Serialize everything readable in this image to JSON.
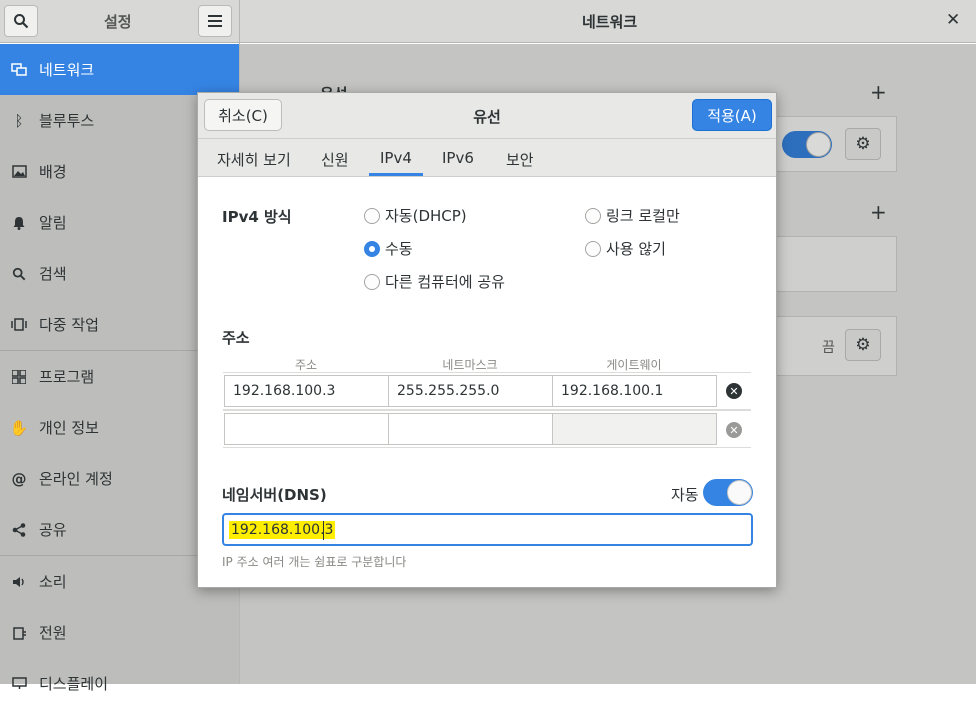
{
  "settings": {
    "title": "설정",
    "search_icon": "search-icon",
    "menu_icon": "hamburger-menu-icon"
  },
  "network_panel": {
    "title": "네트워크",
    "close_icon": "close-icon",
    "wired_heading_partial": "유선",
    "off_label": "끔"
  },
  "sidebar": {
    "items": [
      {
        "label": "네트워크",
        "icon": "network-icon",
        "active": true
      },
      {
        "label": "블루투스",
        "icon": "bluetooth-icon"
      },
      {
        "label": "배경",
        "icon": "background-icon"
      },
      {
        "label": "알림",
        "icon": "bell-icon"
      },
      {
        "label": "검색",
        "icon": "search-icon"
      },
      {
        "label": "다중 작업",
        "icon": "multitasking-icon"
      },
      {
        "label": "프로그램",
        "icon": "apps-grid-icon"
      },
      {
        "label": "개인 정보",
        "icon": "hand-icon"
      },
      {
        "label": "온라인 계정",
        "icon": "at-icon"
      },
      {
        "label": "공유",
        "icon": "share-icon"
      },
      {
        "label": "소리",
        "icon": "speaker-icon"
      },
      {
        "label": "전원",
        "icon": "power-icon"
      },
      {
        "label": "디스플레이",
        "icon": "display-icon"
      }
    ]
  },
  "dialog": {
    "title": "유선",
    "cancel_label": "취소(C)",
    "apply_label": "적용(A)",
    "tabs": [
      "자세히 보기",
      "신원",
      "IPv4",
      "IPv6",
      "보안"
    ],
    "active_tab": "IPv4",
    "ipv4_method": {
      "label": "IPv4 방식",
      "options": {
        "auto_dhcp": "자동(DHCP)",
        "link_local": "링크 로컬만",
        "manual": "수동",
        "disable": "사용 않기",
        "shared": "다른 컴퓨터에 공유"
      },
      "selected": "수동"
    },
    "addresses": {
      "label": "주소",
      "columns": [
        "주소",
        "네트마스크",
        "게이트웨이"
      ],
      "rows": [
        {
          "address": "192.168.100.3",
          "netmask": "255.255.255.0",
          "gateway": "192.168.100.1"
        },
        {
          "address": "",
          "netmask": "",
          "gateway": ""
        }
      ]
    },
    "dns": {
      "label": "네임서버(DNS)",
      "auto_label": "자동",
      "auto_enabled": true,
      "value": "192.168.100.3",
      "hint": "IP 주소 여러 개는 쉼표로 구분합니다"
    }
  },
  "colors": {
    "accent": "#3584e4",
    "highlight": "#ffee00"
  }
}
